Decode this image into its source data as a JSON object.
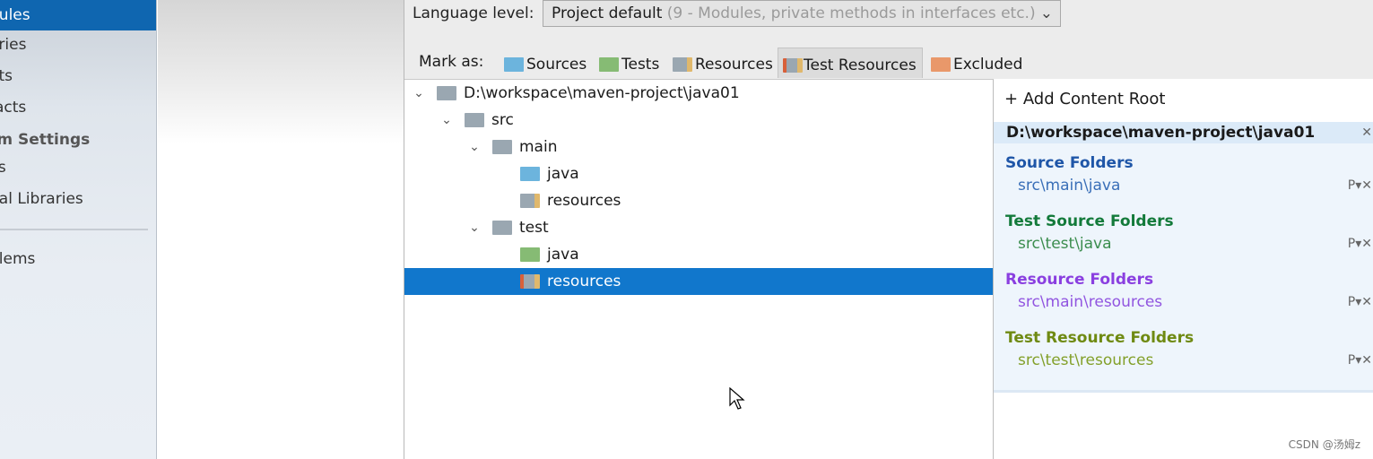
{
  "sidebar": {
    "items": [
      "dules",
      "aries",
      "ets",
      "facts",
      "rm Settings",
      "ks",
      "bal Libraries",
      "blems"
    ]
  },
  "language": {
    "label": "Language level:",
    "value": "Project default",
    "hint": "(9 - Modules, private methods in interfaces etc.)"
  },
  "mark_as": {
    "label": "Mark as:",
    "buttons": [
      {
        "label": "Sources",
        "color": "#6cb4dd"
      },
      {
        "label": "Tests",
        "color": "#86bb74"
      },
      {
        "label": "Resources",
        "color": "#9aa7b1"
      },
      {
        "label": "Test Resources",
        "color": "#9aa7b1"
      },
      {
        "label": "Excluded",
        "color": "#e9986a"
      }
    ]
  },
  "tree": [
    {
      "label": "D:\\workspace\\maven-project\\java01",
      "level": 0,
      "expanded": true,
      "icon": "folder-gray"
    },
    {
      "label": "src",
      "level": 1,
      "expanded": true,
      "icon": "folder-gray"
    },
    {
      "label": "main",
      "level": 2,
      "expanded": true,
      "icon": "folder-gray"
    },
    {
      "label": "java",
      "level": 3,
      "icon": "folder-source"
    },
    {
      "label": "resources",
      "level": 3,
      "icon": "folder-resources"
    },
    {
      "label": "test",
      "level": 2,
      "expanded": true,
      "icon": "folder-gray"
    },
    {
      "label": "java",
      "level": 3,
      "icon": "folder-test"
    },
    {
      "label": "resources",
      "level": 3,
      "icon": "folder-test-resources",
      "selected": true
    }
  ],
  "content_root": {
    "add_label": "Add Content Root",
    "path": "D:\\workspace\\maven-project\\java01",
    "sections": [
      {
        "title": "Source Folders",
        "path": "src\\main\\java",
        "color": "#1f56a8",
        "path_color": "#3a6fb8"
      },
      {
        "title": "Test Source Folders",
        "path": "src\\test\\java",
        "color": "#137a3a",
        "path_color": "#3b8d4e"
      },
      {
        "title": "Resource Folders",
        "path": "src\\main\\resources",
        "color": "#8a3fe0",
        "path_color": "#9155e0"
      },
      {
        "title": "Test Resource Folders",
        "path": "src\\test\\resources",
        "color": "#6f8a12",
        "path_color": "#83a02a"
      }
    ]
  },
  "watermark": "CSDN @汤姆z"
}
